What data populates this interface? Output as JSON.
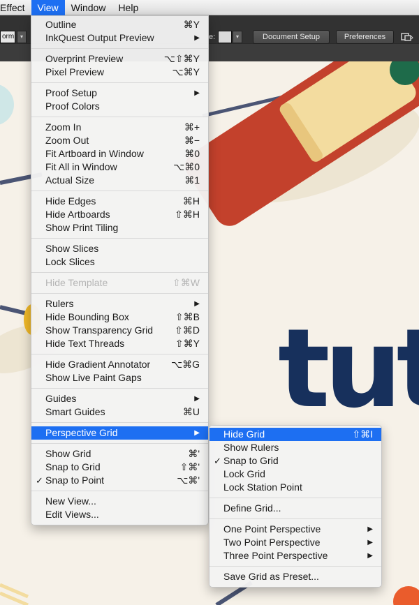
{
  "menubar": {
    "items": [
      "Effect",
      "View",
      "Window",
      "Help"
    ],
    "active": "View"
  },
  "control_bar": {
    "left_field_value": "orm",
    "right_label": "e:",
    "document_setup_label": "Document Setup",
    "preferences_label": "Preferences",
    "arrange_icon": "arrange-documents-icon"
  },
  "artwork": {
    "text": "tuts",
    "colors": {
      "background": "#f6f1e8",
      "navy": "#17305c",
      "red": "#c3412c",
      "cream": "#f3dc9f",
      "green": "#1e6b4a",
      "yellow": "#f0b828",
      "line": "#4b5574",
      "orange": "#ea5c2c",
      "teal_circle": "#cfe7e7"
    }
  },
  "view_menu": {
    "groups": [
      [
        {
          "label": "Outline",
          "shortcut": "⌘Y"
        },
        {
          "label": "InkQuest Output Preview",
          "submenu": true
        }
      ],
      [
        {
          "label": "Overprint Preview",
          "shortcut": "⌥⇧⌘Y"
        },
        {
          "label": "Pixel Preview",
          "shortcut": "⌥⌘Y"
        }
      ],
      [
        {
          "label": "Proof Setup",
          "submenu": true
        },
        {
          "label": "Proof Colors"
        }
      ],
      [
        {
          "label": "Zoom In",
          "shortcut": "⌘+"
        },
        {
          "label": "Zoom Out",
          "shortcut": "⌘−"
        },
        {
          "label": "Fit Artboard in Window",
          "shortcut": "⌘0"
        },
        {
          "label": "Fit All in Window",
          "shortcut": "⌥⌘0"
        },
        {
          "label": "Actual Size",
          "shortcut": "⌘1"
        }
      ],
      [
        {
          "label": "Hide Edges",
          "shortcut": "⌘H"
        },
        {
          "label": "Hide Artboards",
          "shortcut": "⇧⌘H"
        },
        {
          "label": "Show Print Tiling"
        }
      ],
      [
        {
          "label": "Show Slices"
        },
        {
          "label": "Lock Slices"
        }
      ],
      [
        {
          "label": "Hide Template",
          "shortcut": "⇧⌘W",
          "disabled": true
        }
      ],
      [
        {
          "label": "Rulers",
          "submenu": true
        },
        {
          "label": "Hide Bounding Box",
          "shortcut": "⇧⌘B"
        },
        {
          "label": "Show Transparency Grid",
          "shortcut": "⇧⌘D"
        },
        {
          "label": "Hide Text Threads",
          "shortcut": "⇧⌘Y"
        }
      ],
      [
        {
          "label": "Hide Gradient Annotator",
          "shortcut": "⌥⌘G"
        },
        {
          "label": "Show Live Paint Gaps"
        }
      ],
      [
        {
          "label": "Guides",
          "submenu": true
        },
        {
          "label": "Smart Guides",
          "shortcut": "⌘U"
        }
      ],
      [
        {
          "label": "Perspective Grid",
          "submenu": true,
          "highlighted": true
        }
      ],
      [
        {
          "label": "Show Grid",
          "shortcut": "⌘'"
        },
        {
          "label": "Snap to Grid",
          "shortcut": "⇧⌘'"
        },
        {
          "label": "Snap to Point",
          "shortcut": "⌥⌘'",
          "checked": true
        }
      ],
      [
        {
          "label": "New View..."
        },
        {
          "label": "Edit Views..."
        }
      ]
    ]
  },
  "perspective_submenu": {
    "groups": [
      [
        {
          "label": "Hide Grid",
          "shortcut": "⇧⌘I",
          "highlighted": true
        },
        {
          "label": "Show Rulers"
        },
        {
          "label": "Snap to Grid",
          "checked": true
        },
        {
          "label": "Lock Grid"
        },
        {
          "label": "Lock Station Point"
        }
      ],
      [
        {
          "label": "Define Grid..."
        }
      ],
      [
        {
          "label": "One Point Perspective",
          "submenu": true
        },
        {
          "label": "Two Point Perspective",
          "submenu": true
        },
        {
          "label": "Three Point Perspective",
          "submenu": true
        }
      ],
      [
        {
          "label": "Save Grid as Preset..."
        }
      ]
    ]
  },
  "glyphs": {
    "check": "✓",
    "submenu_arrow": "▶",
    "dropdown_arrow": "▾"
  }
}
